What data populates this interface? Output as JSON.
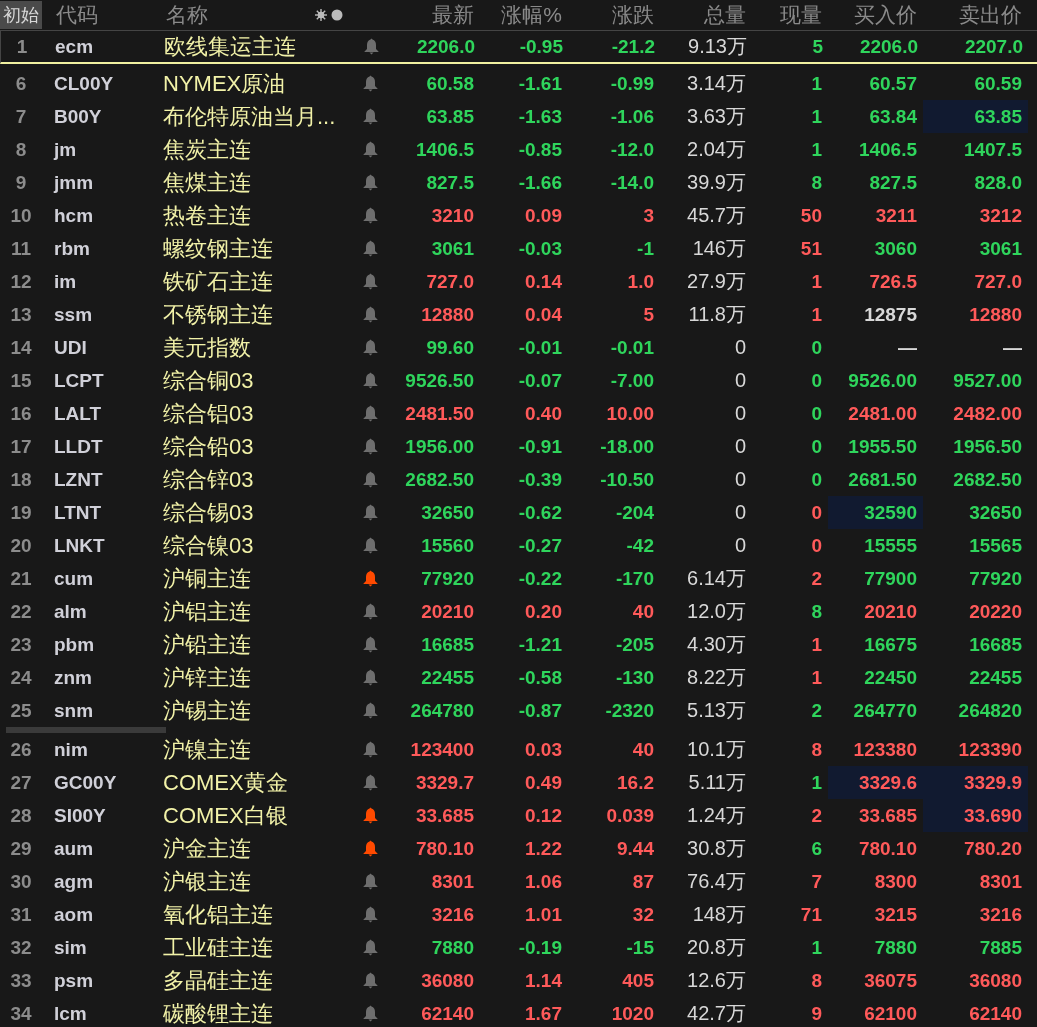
{
  "reset_button": "初始",
  "columns": [
    "代码",
    "名称",
    "最新",
    "涨幅%",
    "涨跌",
    "总量",
    "现量",
    "买入价",
    "卖出价"
  ],
  "pinned_row": {
    "index": "1",
    "code": "ecm",
    "name": "欧线集运主连",
    "alert": false,
    "last": "2206.0",
    "pct": "-0.95",
    "chg": "-21.2",
    "vol": "9.13万",
    "color": "#2fd55c",
    "tick": {
      "text": "5",
      "color": "#2fd55c"
    },
    "bid": {
      "text": "2206.0",
      "color": "#2fd55c",
      "highlighted": false
    },
    "ask": {
      "text": "2207.0",
      "color": "#2fd55c",
      "highlighted": false
    }
  },
  "rows": [
    {
      "index": "6",
      "code": "CL00Y",
      "name": "NYMEX原油",
      "alert": false,
      "last": "60.58",
      "pct": "-1.61",
      "chg": "-0.99",
      "vol": "3.14万",
      "color": "#2fd55c",
      "tick": {
        "text": "1",
        "color": "#2fd55c"
      },
      "bid": {
        "text": "60.57",
        "color": "#2fd55c",
        "highlighted": false
      },
      "ask": {
        "text": "60.59",
        "color": "#2fd55c",
        "highlighted": false
      }
    },
    {
      "index": "7",
      "code": "B00Y",
      "name": "布伦特原油当月...",
      "alert": false,
      "last": "63.85",
      "pct": "-1.63",
      "chg": "-1.06",
      "vol": "3.63万",
      "color": "#2fd55c",
      "tick": {
        "text": "1",
        "color": "#2fd55c"
      },
      "bid": {
        "text": "63.84",
        "color": "#2fd55c",
        "highlighted": false
      },
      "ask": {
        "text": "63.85",
        "color": "#2fd55c",
        "highlighted": true
      }
    },
    {
      "index": "8",
      "code": "jm",
      "name": "焦炭主连",
      "alert": false,
      "last": "1406.5",
      "pct": "-0.85",
      "chg": "-12.0",
      "vol": "2.04万",
      "color": "#2fd55c",
      "tick": {
        "text": "1",
        "color": "#2fd55c"
      },
      "bid": {
        "text": "1406.5",
        "color": "#2fd55c",
        "highlighted": false
      },
      "ask": {
        "text": "1407.5",
        "color": "#2fd55c",
        "highlighted": false
      }
    },
    {
      "index": "9",
      "code": "jmm",
      "name": "焦煤主连",
      "alert": false,
      "last": "827.5",
      "pct": "-1.66",
      "chg": "-14.0",
      "vol": "39.9万",
      "color": "#2fd55c",
      "tick": {
        "text": "8",
        "color": "#2fd55c"
      },
      "bid": {
        "text": "827.5",
        "color": "#2fd55c",
        "highlighted": false
      },
      "ask": {
        "text": "828.0",
        "color": "#2fd55c",
        "highlighted": false
      }
    },
    {
      "index": "10",
      "code": "hcm",
      "name": "热卷主连",
      "alert": false,
      "last": "3210",
      "pct": "0.09",
      "chg": "3",
      "vol": "45.7万",
      "color": "#ff5a5a",
      "tick": {
        "text": "50",
        "color": "#ff5a5a"
      },
      "bid": {
        "text": "3211",
        "color": "#ff5a5a",
        "highlighted": false
      },
      "ask": {
        "text": "3212",
        "color": "#ff5a5a",
        "highlighted": false
      }
    },
    {
      "index": "11",
      "code": "rbm",
      "name": "螺纹钢主连",
      "alert": false,
      "last": "3061",
      "pct": "-0.03",
      "chg": "-1",
      "vol": "146万",
      "color": "#2fd55c",
      "tick": {
        "text": "51",
        "color": "#ff5a5a"
      },
      "bid": {
        "text": "3060",
        "color": "#2fd55c",
        "highlighted": false
      },
      "ask": {
        "text": "3061",
        "color": "#2fd55c",
        "highlighted": false
      }
    },
    {
      "index": "12",
      "code": "im",
      "name": "铁矿石主连",
      "alert": false,
      "last": "727.0",
      "pct": "0.14",
      "chg": "1.0",
      "vol": "27.9万",
      "color": "#ff5a5a",
      "tick": {
        "text": "1",
        "color": "#ff5a5a"
      },
      "bid": {
        "text": "726.5",
        "color": "#ff5a5a",
        "highlighted": false
      },
      "ask": {
        "text": "727.0",
        "color": "#ff5a5a",
        "highlighted": false
      }
    },
    {
      "index": "13",
      "code": "ssm",
      "name": "不锈钢主连",
      "alert": false,
      "last": "12880",
      "pct": "0.04",
      "chg": "5",
      "vol": "11.8万",
      "color": "#ff5a5a",
      "tick": {
        "text": "1",
        "color": "#ff5a5a"
      },
      "bid": {
        "text": "12875",
        "color": "#d8d8d8",
        "highlighted": false
      },
      "ask": {
        "text": "12880",
        "color": "#ff5a5a",
        "highlighted": false
      }
    },
    {
      "index": "14",
      "code": "UDI",
      "name": "美元指数",
      "alert": false,
      "last": "99.60",
      "pct": "-0.01",
      "chg": "-0.01",
      "vol": "0",
      "color": "#2fd55c",
      "tick": {
        "text": "0",
        "color": "#2fd55c"
      },
      "bid": {
        "text": "—",
        "color": "#d8d8d8",
        "highlighted": false
      },
      "ask": {
        "text": "—",
        "color": "#d8d8d8",
        "highlighted": false
      }
    },
    {
      "index": "15",
      "code": "LCPT",
      "name": "综合铜03",
      "alert": false,
      "last": "9526.50",
      "pct": "-0.07",
      "chg": "-7.00",
      "vol": "0",
      "color": "#2fd55c",
      "tick": {
        "text": "0",
        "color": "#2fd55c"
      },
      "bid": {
        "text": "9526.00",
        "color": "#2fd55c",
        "highlighted": false
      },
      "ask": {
        "text": "9527.00",
        "color": "#2fd55c",
        "highlighted": false
      }
    },
    {
      "index": "16",
      "code": "LALT",
      "name": "综合铝03",
      "alert": false,
      "last": "2481.50",
      "pct": "0.40",
      "chg": "10.00",
      "vol": "0",
      "color": "#ff5a5a",
      "tick": {
        "text": "0",
        "color": "#2fd55c"
      },
      "bid": {
        "text": "2481.00",
        "color": "#ff5a5a",
        "highlighted": false
      },
      "ask": {
        "text": "2482.00",
        "color": "#ff5a5a",
        "highlighted": false
      }
    },
    {
      "index": "17",
      "code": "LLDT",
      "name": "综合铅03",
      "alert": false,
      "last": "1956.00",
      "pct": "-0.91",
      "chg": "-18.00",
      "vol": "0",
      "color": "#2fd55c",
      "tick": {
        "text": "0",
        "color": "#2fd55c"
      },
      "bid": {
        "text": "1955.50",
        "color": "#2fd55c",
        "highlighted": false
      },
      "ask": {
        "text": "1956.50",
        "color": "#2fd55c",
        "highlighted": false
      }
    },
    {
      "index": "18",
      "code": "LZNT",
      "name": "综合锌03",
      "alert": false,
      "last": "2682.50",
      "pct": "-0.39",
      "chg": "-10.50",
      "vol": "0",
      "color": "#2fd55c",
      "tick": {
        "text": "0",
        "color": "#2fd55c"
      },
      "bid": {
        "text": "2681.50",
        "color": "#2fd55c",
        "highlighted": false
      },
      "ask": {
        "text": "2682.50",
        "color": "#2fd55c",
        "highlighted": false
      }
    },
    {
      "index": "19",
      "code": "LTNT",
      "name": "综合锡03",
      "alert": false,
      "last": "32650",
      "pct": "-0.62",
      "chg": "-204",
      "vol": "0",
      "color": "#2fd55c",
      "tick": {
        "text": "0",
        "color": "#ff5a5a"
      },
      "bid": {
        "text": "32590",
        "color": "#2fd55c",
        "highlighted": true
      },
      "ask": {
        "text": "32650",
        "color": "#2fd55c",
        "highlighted": false
      }
    },
    {
      "index": "20",
      "code": "LNKT",
      "name": "综合镍03",
      "alert": false,
      "last": "15560",
      "pct": "-0.27",
      "chg": "-42",
      "vol": "0",
      "color": "#2fd55c",
      "tick": {
        "text": "0",
        "color": "#ff5a5a"
      },
      "bid": {
        "text": "15555",
        "color": "#2fd55c",
        "highlighted": false
      },
      "ask": {
        "text": "15565",
        "color": "#2fd55c",
        "highlighted": false
      }
    },
    {
      "index": "21",
      "code": "cum",
      "name": "沪铜主连",
      "alert": true,
      "last": "77920",
      "pct": "-0.22",
      "chg": "-170",
      "vol": "6.14万",
      "color": "#2fd55c",
      "tick": {
        "text": "2",
        "color": "#ff5a5a"
      },
      "bid": {
        "text": "77900",
        "color": "#2fd55c",
        "highlighted": false
      },
      "ask": {
        "text": "77920",
        "color": "#2fd55c",
        "highlighted": false
      }
    },
    {
      "index": "22",
      "code": "alm",
      "name": "沪铝主连",
      "alert": false,
      "last": "20210",
      "pct": "0.20",
      "chg": "40",
      "vol": "12.0万",
      "color": "#ff5a5a",
      "tick": {
        "text": "8",
        "color": "#2fd55c"
      },
      "bid": {
        "text": "20210",
        "color": "#ff5a5a",
        "highlighted": false
      },
      "ask": {
        "text": "20220",
        "color": "#ff5a5a",
        "highlighted": false
      }
    },
    {
      "index": "23",
      "code": "pbm",
      "name": "沪铅主连",
      "alert": false,
      "last": "16685",
      "pct": "-1.21",
      "chg": "-205",
      "vol": "4.30万",
      "color": "#2fd55c",
      "tick": {
        "text": "1",
        "color": "#ff5a5a"
      },
      "bid": {
        "text": "16675",
        "color": "#2fd55c",
        "highlighted": false
      },
      "ask": {
        "text": "16685",
        "color": "#2fd55c",
        "highlighted": false
      }
    },
    {
      "index": "24",
      "code": "znm",
      "name": "沪锌主连",
      "alert": false,
      "last": "22455",
      "pct": "-0.58",
      "chg": "-130",
      "vol": "8.22万",
      "color": "#2fd55c",
      "tick": {
        "text": "1",
        "color": "#ff5a5a"
      },
      "bid": {
        "text": "22450",
        "color": "#2fd55c",
        "highlighted": false
      },
      "ask": {
        "text": "22455",
        "color": "#2fd55c",
        "highlighted": false
      }
    },
    {
      "index": "25",
      "code": "snm",
      "name": "沪锡主连",
      "alert": false,
      "last": "264780",
      "pct": "-0.87",
      "chg": "-2320",
      "vol": "5.13万",
      "color": "#2fd55c",
      "tick": {
        "text": "2",
        "color": "#2fd55c"
      },
      "bid": {
        "text": "264770",
        "color": "#2fd55c",
        "highlighted": false
      },
      "ask": {
        "text": "264820",
        "color": "#2fd55c",
        "highlighted": false
      }
    },
    {
      "index": "26",
      "code": "nim",
      "name": "沪镍主连",
      "alert": false,
      "last": "123400",
      "pct": "0.03",
      "chg": "40",
      "vol": "10.1万",
      "color": "#ff5a5a",
      "tick": {
        "text": "8",
        "color": "#ff5a5a"
      },
      "bid": {
        "text": "123380",
        "color": "#ff5a5a",
        "highlighted": false
      },
      "ask": {
        "text": "123390",
        "color": "#ff5a5a",
        "highlighted": false
      }
    },
    {
      "index": "27",
      "code": "GC00Y",
      "name": "COMEX黄金",
      "alert": false,
      "last": "3329.7",
      "pct": "0.49",
      "chg": "16.2",
      "vol": "5.11万",
      "color": "#ff5a5a",
      "tick": {
        "text": "1",
        "color": "#2fd55c"
      },
      "bid": {
        "text": "3329.6",
        "color": "#ff5a5a",
        "highlighted": true
      },
      "ask": {
        "text": "3329.9",
        "color": "#ff5a5a",
        "highlighted": true
      }
    },
    {
      "index": "28",
      "code": "SI00Y",
      "name": "COMEX白银",
      "alert": true,
      "last": "33.685",
      "pct": "0.12",
      "chg": "0.039",
      "vol": "1.24万",
      "color": "#ff5a5a",
      "tick": {
        "text": "2",
        "color": "#ff5a5a"
      },
      "bid": {
        "text": "33.685",
        "color": "#ff5a5a",
        "highlighted": false
      },
      "ask": {
        "text": "33.690",
        "color": "#ff5a5a",
        "highlighted": true
      }
    },
    {
      "index": "29",
      "code": "aum",
      "name": "沪金主连",
      "alert": true,
      "last": "780.10",
      "pct": "1.22",
      "chg": "9.44",
      "vol": "30.8万",
      "color": "#ff5a5a",
      "tick": {
        "text": "6",
        "color": "#2fd55c"
      },
      "bid": {
        "text": "780.10",
        "color": "#ff5a5a",
        "highlighted": false
      },
      "ask": {
        "text": "780.20",
        "color": "#ff5a5a",
        "highlighted": false
      }
    },
    {
      "index": "30",
      "code": "agm",
      "name": "沪银主连",
      "alert": false,
      "last": "8301",
      "pct": "1.06",
      "chg": "87",
      "vol": "76.4万",
      "color": "#ff5a5a",
      "tick": {
        "text": "7",
        "color": "#ff5a5a"
      },
      "bid": {
        "text": "8300",
        "color": "#ff5a5a",
        "highlighted": false
      },
      "ask": {
        "text": "8301",
        "color": "#ff5a5a",
        "highlighted": false
      }
    },
    {
      "index": "31",
      "code": "aom",
      "name": "氧化铝主连",
      "alert": false,
      "last": "3216",
      "pct": "1.01",
      "chg": "32",
      "vol": "148万",
      "color": "#ff5a5a",
      "tick": {
        "text": "71",
        "color": "#ff5a5a"
      },
      "bid": {
        "text": "3215",
        "color": "#ff5a5a",
        "highlighted": false
      },
      "ask": {
        "text": "3216",
        "color": "#ff5a5a",
        "highlighted": false
      }
    },
    {
      "index": "32",
      "code": "sim",
      "name": "工业硅主连",
      "alert": false,
      "last": "7880",
      "pct": "-0.19",
      "chg": "-15",
      "vol": "20.8万",
      "color": "#2fd55c",
      "tick": {
        "text": "1",
        "color": "#2fd55c"
      },
      "bid": {
        "text": "7880",
        "color": "#2fd55c",
        "highlighted": false
      },
      "ask": {
        "text": "7885",
        "color": "#2fd55c",
        "highlighted": false
      }
    },
    {
      "index": "33",
      "code": "psm",
      "name": "多晶硅主连",
      "alert": false,
      "last": "36080",
      "pct": "1.14",
      "chg": "405",
      "vol": "12.6万",
      "color": "#ff5a5a",
      "tick": {
        "text": "8",
        "color": "#ff5a5a"
      },
      "bid": {
        "text": "36075",
        "color": "#ff5a5a",
        "highlighted": false
      },
      "ask": {
        "text": "36080",
        "color": "#ff5a5a",
        "highlighted": false
      }
    },
    {
      "index": "34",
      "code": "lcm",
      "name": "碳酸锂主连",
      "alert": false,
      "last": "62140",
      "pct": "1.67",
      "chg": "1020",
      "vol": "42.7万",
      "color": "#ff5a5a",
      "tick": {
        "text": "9",
        "color": "#ff5a5a"
      },
      "bid": {
        "text": "62100",
        "color": "#ff5a5a",
        "highlighted": false
      },
      "ask": {
        "text": "62140",
        "color": "#ff5a5a",
        "highlighted": false
      }
    }
  ]
}
